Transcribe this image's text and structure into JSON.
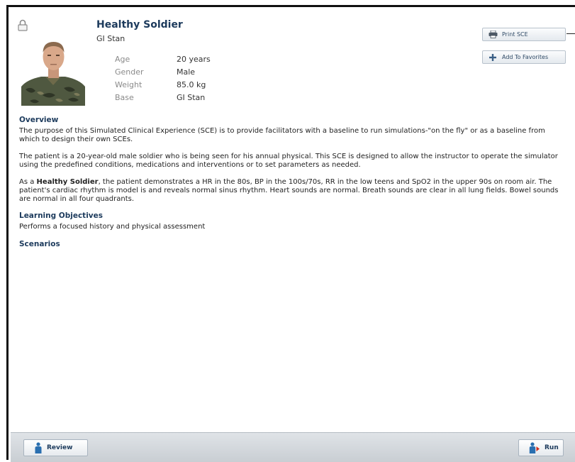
{
  "patient": {
    "title": "Healthy Soldier",
    "subtitle": "GI Stan",
    "info": [
      {
        "label": "Age",
        "value": "20 years"
      },
      {
        "label": "Gender",
        "value": "Male"
      },
      {
        "label": "Weight",
        "value": "85.0 kg"
      },
      {
        "label": "Base",
        "value": "GI Stan"
      }
    ]
  },
  "actions": {
    "print_label": "Print SCE",
    "favorites_label": "Add To Favorites"
  },
  "overview": {
    "heading": "Overview",
    "p1": "The purpose of this Simulated Clinical Experience (SCE) is to provide facilitators with a baseline to run simulations-\"on the fly\" or as a baseline from which to design their own SCEs.",
    "p2": "The patient is a 20-year-old male soldier who is being seen for his annual physical. This SCE is designed to allow the instructor to operate the simulator using the predefined conditions, medications and interventions or to set parameters as needed.",
    "p3_prefix": "As a ",
    "p3_bold": "Healthy Soldier",
    "p3_rest": ", the patient demonstrates a HR in the 80s, BP in the 100s/70s, RR in the low teens and SpO2 in the upper 90s on room air. The patient's cardiac rhythm is model is and reveals normal sinus rhythm. Heart sounds are normal. Breath sounds are clear in all lung fields. Bowel sounds are normal in all four quadrants."
  },
  "learning": {
    "heading": "Learning Objectives",
    "text": "Performs a focused history and physical assessment"
  },
  "scenarios": {
    "heading": "Scenarios"
  },
  "footer": {
    "review_label": "Review",
    "run_label": "Run"
  },
  "icons": {
    "lock": "lock-icon",
    "print": "printer-icon",
    "favorites": "plus-icon",
    "review": "person-icon",
    "run": "person-run-icon"
  },
  "colors": {
    "heading": "#1c3a5c",
    "bar": "#c9ced3"
  }
}
